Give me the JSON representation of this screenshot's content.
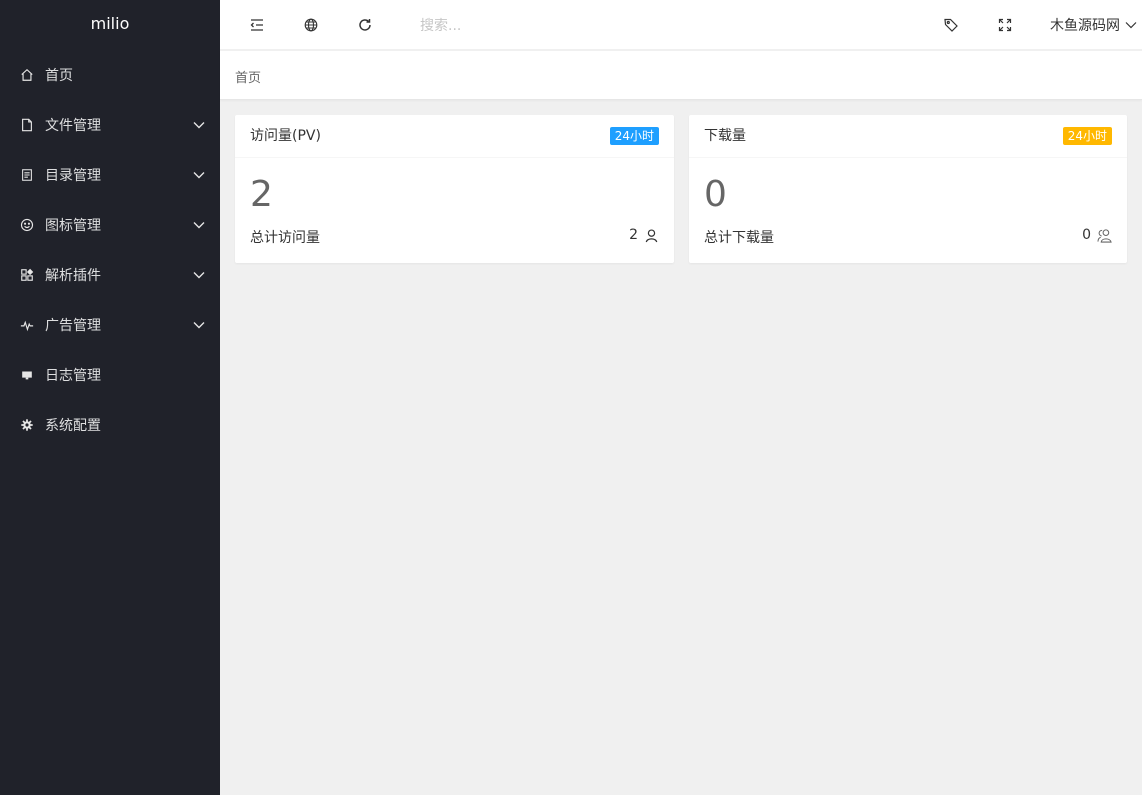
{
  "sidebar": {
    "logo": "milio",
    "items": [
      {
        "label": "首页",
        "icon": "home-icon",
        "has_children": false
      },
      {
        "label": "文件管理",
        "icon": "file-icon",
        "has_children": true
      },
      {
        "label": "目录管理",
        "icon": "document-icon",
        "has_children": true
      },
      {
        "label": "图标管理",
        "icon": "smile-icon",
        "has_children": true
      },
      {
        "label": "解析插件",
        "icon": "apps-icon",
        "has_children": true
      },
      {
        "label": "广告管理",
        "icon": "pulse-icon",
        "has_children": true
      },
      {
        "label": "日志管理",
        "icon": "monitor-icon",
        "has_children": false
      },
      {
        "label": "系统配置",
        "icon": "settings-icon",
        "has_children": false
      }
    ]
  },
  "header": {
    "search_placeholder": "搜索...",
    "user_name": "木鱼源码网",
    "icons": [
      "menu-fold-icon",
      "globe-icon",
      "refresh-icon",
      "tag-icon",
      "fullscreen-icon",
      "chevron-down-icon"
    ]
  },
  "breadcrumb": "首页",
  "cards": [
    {
      "title": "访问量(PV)",
      "badge": "24小时",
      "badge_color": "#1e9fff",
      "value": "2",
      "footer_label": "总计访问量",
      "footer_value": "2",
      "icon": "user-icon"
    },
    {
      "title": "下载量",
      "badge": "24小时",
      "badge_color": "#ffb800",
      "value": "0",
      "footer_label": "总计下载量",
      "footer_value": "0",
      "icon": "users-icon"
    }
  ],
  "colors": {
    "sidebar_bg": "#20222a",
    "blue": "#1e9fff",
    "orange": "#ffb800"
  }
}
